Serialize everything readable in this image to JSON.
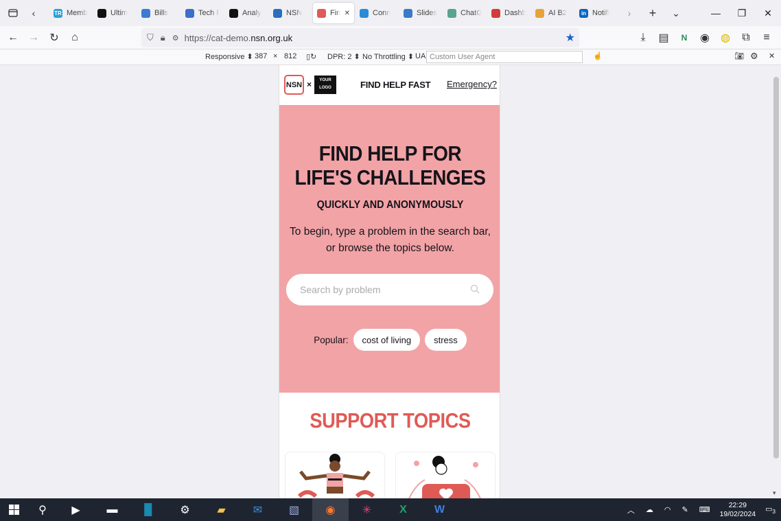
{
  "browser": {
    "tabs": [
      {
        "label": "Memb",
        "fav": "TR",
        "color": "#2b9fd9"
      },
      {
        "label": "Ultim",
        "fav": "",
        "color": "#111111"
      },
      {
        "label": "Bills",
        "fav": "",
        "color": "#3b7bd4"
      },
      {
        "label": "Tech F",
        "fav": "",
        "color": "#3b6fc9"
      },
      {
        "label": "Analy",
        "fav": "",
        "color": "#111111"
      },
      {
        "label": "NSN",
        "fav": "",
        "color": "#2a6ebd"
      },
      {
        "label": "Find",
        "fav": "",
        "color": "#e05a55",
        "active": true
      },
      {
        "label": "Conn",
        "fav": "",
        "color": "#2a8bd6"
      },
      {
        "label": "Slides",
        "fav": "",
        "color": "#3c79c8"
      },
      {
        "label": "ChatG",
        "fav": "",
        "color": "#5aa38e"
      },
      {
        "label": "Dashb",
        "fav": "",
        "color": "#d23b3b"
      },
      {
        "label": "AI B2",
        "fav": "",
        "color": "#e8a23a"
      },
      {
        "label": "Notifi",
        "fav": "in",
        "color": "#0a66c2"
      }
    ],
    "url": "https://cat-demo.nsn.org.uk",
    "url_host": "nsn.org.uk",
    "url_prefix": "https://cat-demo."
  },
  "rdm": {
    "mode": "Responsive",
    "width": "387",
    "x": "×",
    "height": "812",
    "dpr": "DPR: 2",
    "throttle": "No Throttling",
    "ua_label": "UA:",
    "ua_placeholder": "Custom User Agent"
  },
  "site": {
    "nsn_logo": "NSN",
    "times": "×",
    "your_logo_1": "YOUR",
    "your_logo_2": "LOGO",
    "header_title": "FIND HELP FAST",
    "emergency": "Emergency?",
    "hero_title_1": "FIND HELP FOR",
    "hero_title_2": "LIFE'S CHALLENGES",
    "hero_sub": "QUICKLY AND ANONYMOUSLY",
    "hero_desc_1": "To begin, type a problem in the search bar,",
    "hero_desc_2": "or browse the topics below.",
    "search_placeholder": "Search by problem",
    "popular_label": "Popular:",
    "popular": [
      "cost of living",
      "stress"
    ],
    "topics_title": "SUPPORT TOPICS",
    "colors": {
      "hero_bg": "#f2a3a6",
      "accent": "#e05a55"
    }
  },
  "taskbar": {
    "time": "22:29",
    "date": "19/02/2024",
    "notifications": "3"
  }
}
